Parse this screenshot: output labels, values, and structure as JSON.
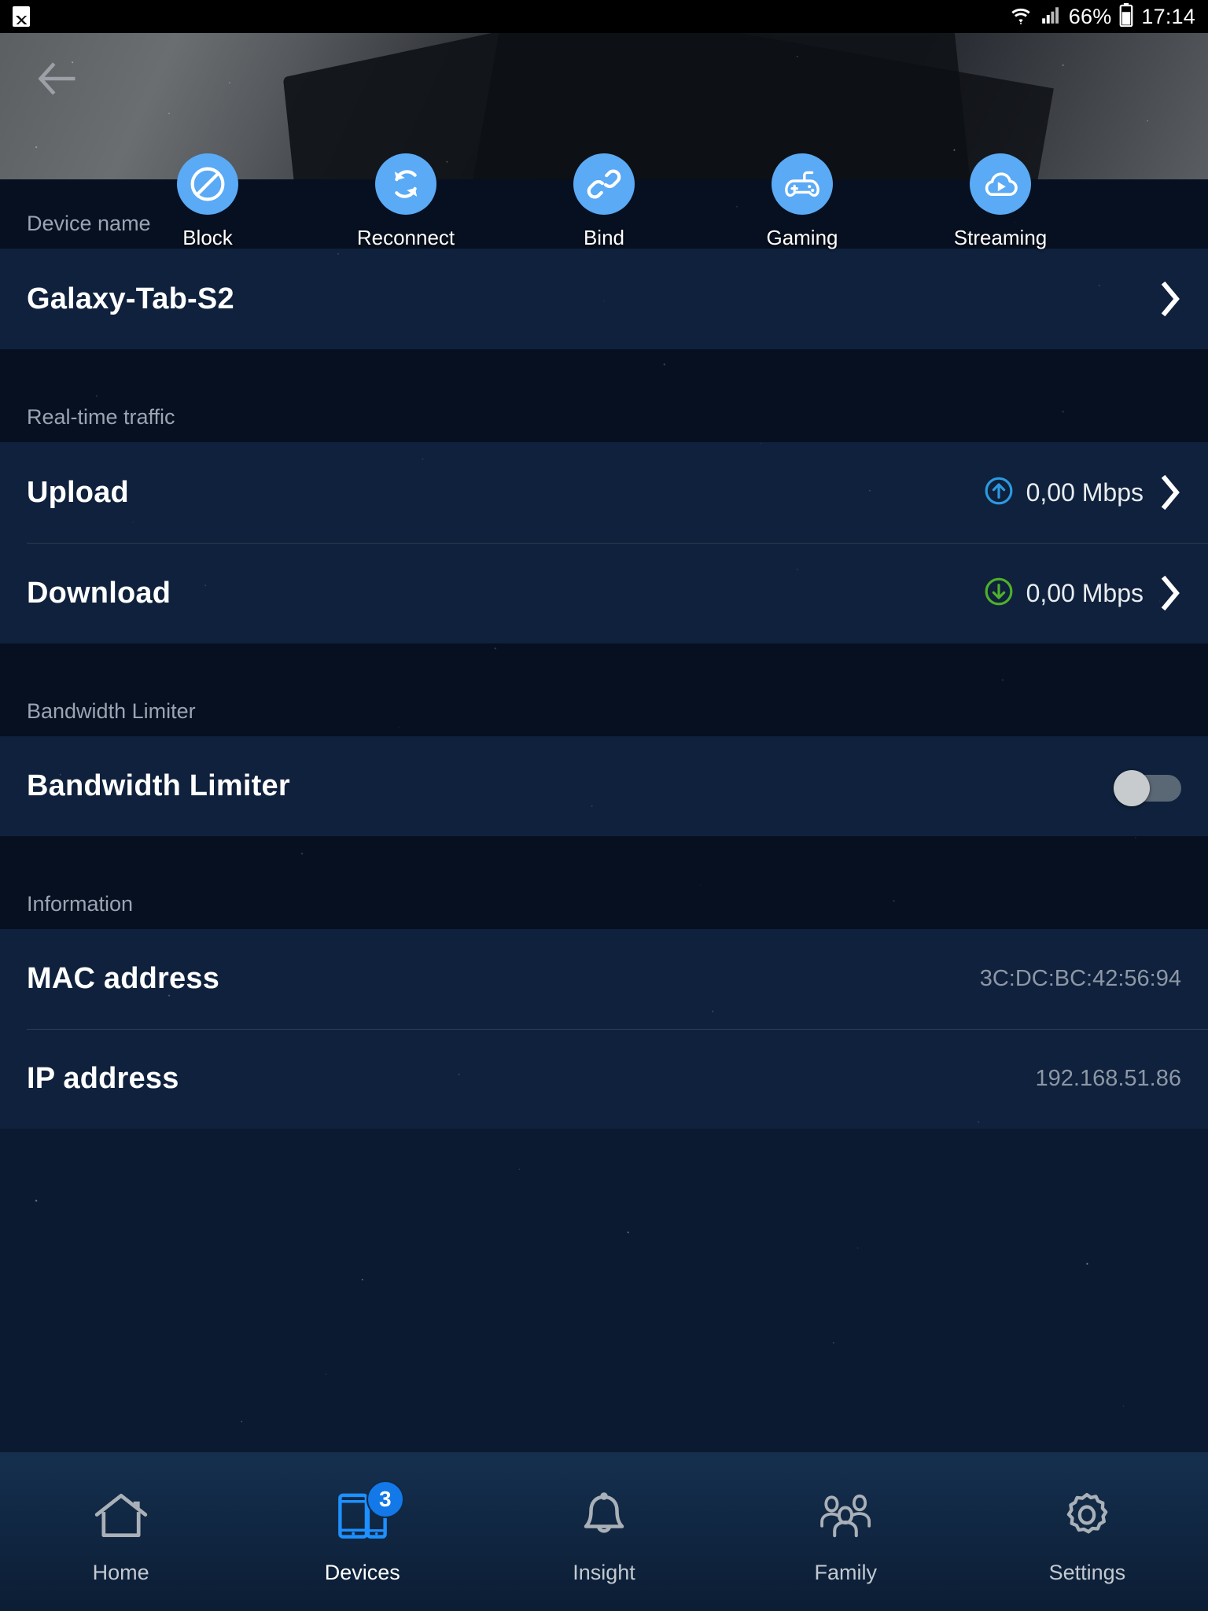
{
  "statusbar": {
    "gallery_icon": "image-icon",
    "wifi_icon": "wifi-icon",
    "signal_icon": "cellular-signal-icon",
    "battery_percent": "66%",
    "battery_icon": "battery-icon",
    "clock": "17:14"
  },
  "header": {
    "back_icon": "back-arrow-icon"
  },
  "actions": [
    {
      "label": "Block",
      "icon": "block-icon"
    },
    {
      "label": "Reconnect",
      "icon": "refresh-icon"
    },
    {
      "label": "Bind",
      "icon": "link-icon"
    },
    {
      "label": "Gaming",
      "icon": "gamepad-icon"
    },
    {
      "label": "Streaming",
      "icon": "cloud-play-icon"
    }
  ],
  "sections": {
    "device_name": {
      "header": "Device name",
      "row_label": "Galaxy-Tab-S2",
      "chevron": "chevron-right-icon"
    },
    "realtime_traffic": {
      "header": "Real-time traffic",
      "upload": {
        "label": "Upload",
        "value": "0,00 Mbps",
        "icon": "upload-arrow-icon",
        "chevron": "chevron-right-icon"
      },
      "download": {
        "label": "Download",
        "value": "0,00 Mbps",
        "icon": "download-arrow-icon",
        "chevron": "chevron-right-icon"
      }
    },
    "bandwidth_limiter": {
      "header": "Bandwidth Limiter",
      "row_label": "Bandwidth Limiter",
      "toggle_state": "off"
    },
    "information": {
      "header": "Information",
      "mac": {
        "label": "MAC address",
        "value": "3C:DC:BC:42:56:94"
      },
      "ip": {
        "label": "IP address",
        "value": "192.168.51.86"
      }
    }
  },
  "bottom_nav": [
    {
      "label": "Home",
      "icon": "home-icon",
      "active": false,
      "badge": ""
    },
    {
      "label": "Devices",
      "icon": "devices-icon",
      "active": true,
      "badge": "3"
    },
    {
      "label": "Insight",
      "icon": "bell-icon",
      "active": false,
      "badge": ""
    },
    {
      "label": "Family",
      "icon": "people-icon",
      "active": false,
      "badge": ""
    },
    {
      "label": "Settings",
      "icon": "gear-icon",
      "active": false,
      "badge": ""
    }
  ],
  "colors": {
    "accent_blue": "#5aaaf5",
    "badge_blue": "#1378e8",
    "upload_blue": "#2b9ae0",
    "download_green": "#4fb02a",
    "section_text": "#9aa4b2"
  }
}
